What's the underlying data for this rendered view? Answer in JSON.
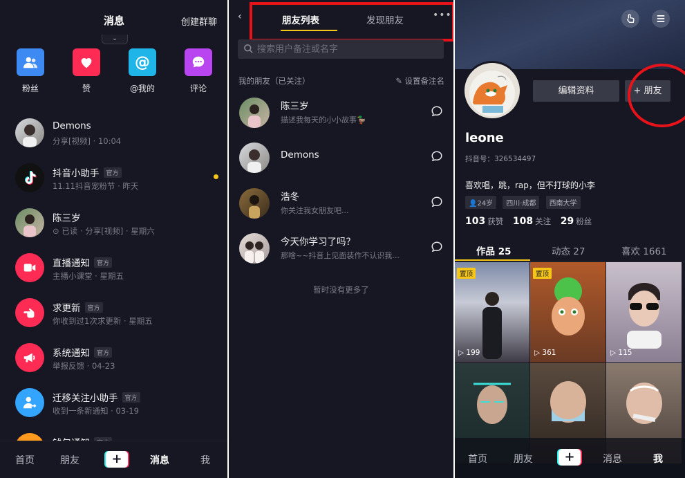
{
  "messages_screen": {
    "title": "消息",
    "create_group": "创建群聊",
    "pull_indicator": "⌄",
    "shortcuts": [
      {
        "label": "粉丝",
        "color": "#3d8bf2"
      },
      {
        "label": "赞",
        "color": "#fe2c55"
      },
      {
        "label": "@我的",
        "color": "#1fb5e8"
      },
      {
        "label": "评论",
        "color": "#b845f0"
      }
    ],
    "items": [
      {
        "name": "Demons",
        "badge": "",
        "sub": "分享[视频] · 10:04"
      },
      {
        "name": "抖音小助手",
        "badge": "官方",
        "sub": "11.11抖音宠粉节 · 昨天",
        "unread": true
      },
      {
        "name": "陈三岁",
        "badge": "",
        "sub": "⊙ 已读 · 分享[视频] · 星期六"
      },
      {
        "name": "直播通知",
        "badge": "官方",
        "sub": "主播小课堂 · 星期五"
      },
      {
        "name": "求更新",
        "badge": "官方",
        "sub": "你收到过1次求更新 · 星期五"
      },
      {
        "name": "系统通知",
        "badge": "官方",
        "sub": "举报反馈 · 04-23"
      },
      {
        "name": "迁移关注小助手",
        "badge": "官方",
        "sub": "收到一条新通知 · 03-19"
      },
      {
        "name": "钱包通知",
        "badge": "官方",
        "sub": ""
      }
    ]
  },
  "friends_screen": {
    "back": "‹",
    "tab_list": "朋友列表",
    "tab_discover": "发现朋友",
    "more": "•••",
    "search_placeholder": "搜索用户备注或名字",
    "section_title": "我的朋友（已关注）",
    "set_note": "设置备注名",
    "friends": [
      {
        "name": "陈三岁",
        "sub": "描述我每天的小小故事🦆"
      },
      {
        "name": "Demons",
        "sub": ""
      },
      {
        "name": "浩冬",
        "sub": "你关注我女朋友吧..."
      },
      {
        "name": "今天你学习了吗？",
        "sub": "那啥~~抖音上见面装作不认识我..."
      }
    ],
    "no_more": "暂时没有更多了"
  },
  "profile_screen": {
    "edit_profile": "编辑资料",
    "add_friend": "+ 朋友",
    "username": "leone",
    "douyin_id": "抖音号：326534497",
    "bio": "喜欢唱，跳，rap，但不打球的小李",
    "tags": {
      "age": "24岁",
      "location": "四川·成都",
      "school": "西南大学"
    },
    "stats": {
      "likes": "103",
      "likes_label": "获赞",
      "following": "108",
      "following_label": "关注",
      "fans": "29",
      "fans_label": "粉丝"
    },
    "tabs": [
      "作品 25",
      "动态 27",
      "喜欢 1661"
    ],
    "pin_label": "置顶",
    "videos": [
      {
        "plays": "199",
        "pinned": true
      },
      {
        "plays": "361",
        "pinned": true
      },
      {
        "plays": "115",
        "pinned": false
      },
      {
        "plays": "",
        "pinned": false
      },
      {
        "plays": "",
        "pinned": false
      },
      {
        "plays": "",
        "pinned": false
      }
    ]
  },
  "tabbar": {
    "home": "首页",
    "friends": "朋友",
    "plus": "+",
    "messages": "消息",
    "me": "我"
  }
}
